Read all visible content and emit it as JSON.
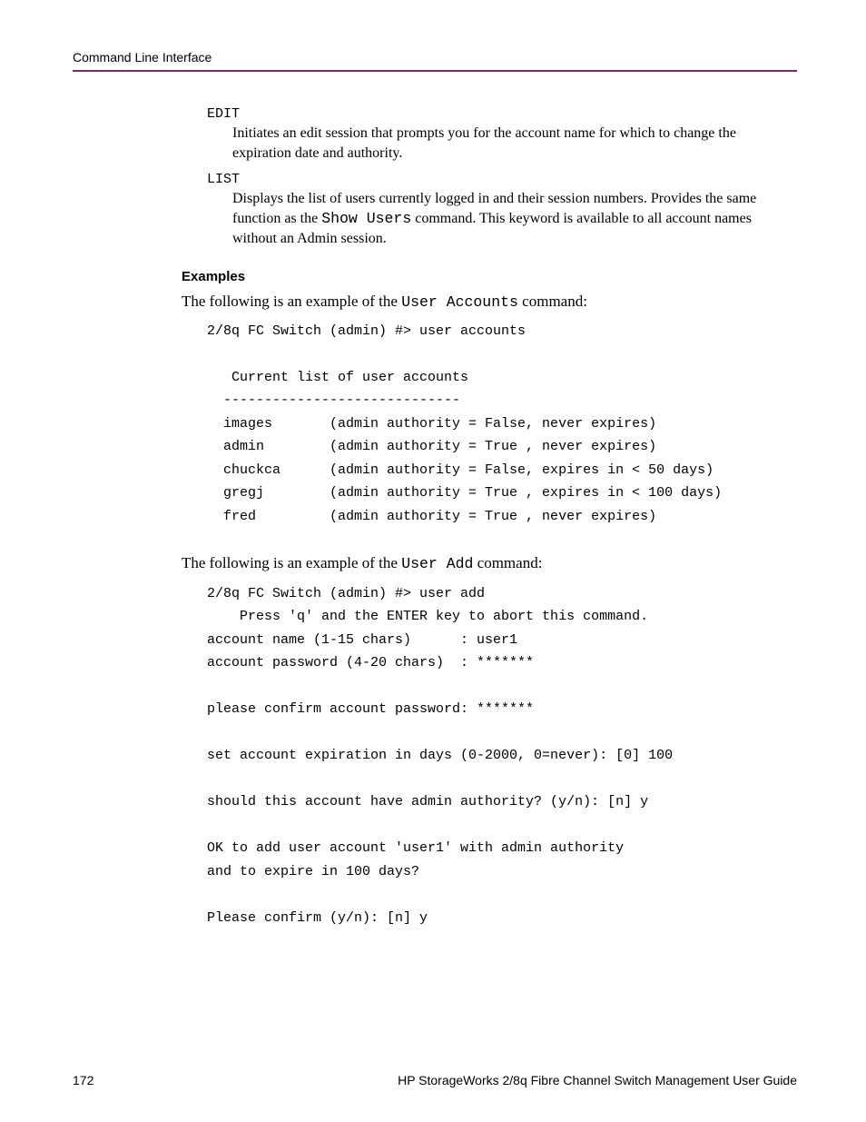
{
  "header": {
    "section": "Command Line Interface"
  },
  "entries": {
    "edit": {
      "term": "EDIT",
      "def": "Initiates an edit session that prompts you for the account name for which to change the expiration date and authority."
    },
    "list": {
      "term": "LIST",
      "def_pre": "Displays the list of users currently logged in and their session numbers. Provides the same function as the ",
      "def_code": "Show Users",
      "def_post": " command. This keyword is available to all account names without an Admin session."
    }
  },
  "examples": {
    "heading": "Examples",
    "intro1_pre": "The following is an example of the ",
    "intro1_code": "User Accounts",
    "intro1_post": " command:",
    "block1": "2/8q FC Switch (admin) #> user accounts\n\n   Current list of user accounts\n  -----------------------------\n  images       (admin authority = False, never expires)\n  admin        (admin authority = True , never expires)\n  chuckca      (admin authority = False, expires in < 50 days)\n  gregj        (admin authority = True , expires in < 100 days)\n  fred         (admin authority = True , never expires)",
    "intro2_pre": "The following is an example of the ",
    "intro2_code": "User Add",
    "intro2_post": " command:",
    "block2": "2/8q FC Switch (admin) #> user add\n    Press 'q' and the ENTER key to abort this command.\naccount name (1-15 chars)      : user1\naccount password (4-20 chars)  : *******\n\nplease confirm account password: *******\n\nset account expiration in days (0-2000, 0=never): [0] 100\n\nshould this account have admin authority? (y/n): [n] y\n\nOK to add user account 'user1' with admin authority\nand to expire in 100 days?\n\nPlease confirm (y/n): [n] y"
  },
  "footer": {
    "page_number": "172",
    "doc_title": "HP StorageWorks 2/8q Fibre Channel Switch Management User Guide"
  }
}
